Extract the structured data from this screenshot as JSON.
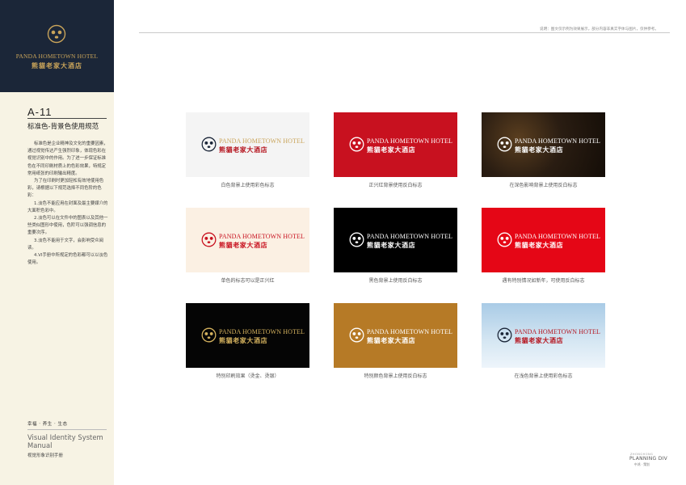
{
  "brand": {
    "name_en": "PANDA HOMETOWN HOTEL",
    "name_cn": "熊貓老家大酒店",
    "colors": {
      "navy": "#1b2638",
      "gold": "#c9a45a",
      "red": "#b5141e",
      "cream": "#f7f3e4"
    }
  },
  "sidebar": {
    "code": "A-11",
    "title": "标准色-背景色使用规范",
    "paragraphs": [
      "标准色是企业精神及文化的重要因素，通过视觉传达产生强烈印象，体现色彩在视觉识别中的作用。为了进一步保证标准色在不同印刷材质上的色彩效果，特规定常用纸张的印刷输出精度。",
      "为了在印刷时更加轻松有效地使用色彩，请根据以下规范选择不同色阶的色彩：",
      "1.淡色不能应用在封面及最主要媒介的大面积色彩中。",
      "2.淡色可以在文件中的图表以及其他一些类似图形中使用，色阶可以强调信息的重要次序。",
      "3.淡色不能用于文字，会影响受众阅读。",
      "4.VI手册中所规定的色彩都可以以淡色使用。"
    ],
    "tagline": "幸福 · 养生 · 生态",
    "manual_en": "Visual Identity System Manual",
    "manual_cn": "视觉形象识别手册"
  },
  "header": {
    "note": "说明：图文仅示例为效果展示，部分内容非真实字体与图片，仅供参考。"
  },
  "cards": [
    {
      "caption": "白色背景上使用彩色标志",
      "bg": "#f4f4f4",
      "text_color": "#c9a45a",
      "cn_color": "#b5141e",
      "mark_color": "#1b2638"
    },
    {
      "caption": "正兴红背景使用反白标志",
      "bg": "#c8111f",
      "text_color": "#ffffff",
      "cn_color": "#ffffff",
      "mark_color": "#ffffff"
    },
    {
      "caption": "在深色影响背景上使用反白标志",
      "bg": "#2a1d12",
      "text_color": "#ffffff",
      "cn_color": "#ffffff",
      "mark_color": "#ffffff"
    },
    {
      "caption": "单色的标志可以是正兴红",
      "bg": "#fbf0e3",
      "text_color": "#c8111f",
      "cn_color": "#c8111f",
      "mark_color": "#c8111f"
    },
    {
      "caption": "黑色背景上使用反白标志",
      "bg": "#000000",
      "text_color": "#ffffff",
      "cn_color": "#ffffff",
      "mark_color": "#ffffff"
    },
    {
      "caption": "遇有特别情况如新年，可使用反白标志",
      "bg": "#e50616",
      "text_color": "#ffffff",
      "cn_color": "#ffffff",
      "mark_color": "#ffffff"
    },
    {
      "caption": "特别印刷效果（烫金、烫银）",
      "bg": "#050505",
      "text_color": "#d5b25e",
      "cn_color": "#d5b25e",
      "mark_color": "#d5b25e"
    },
    {
      "caption": "特别颜色背景上使用反白标志",
      "bg": "#b67a26",
      "text_color": "#ffffff",
      "cn_color": "#ffffff",
      "mark_color": "#ffffff"
    },
    {
      "caption": "在浅色背景上使用彩色标志",
      "bg": "#bcd6ea",
      "text_color": "#b5141e",
      "cn_color": "#b5141e",
      "mark_color": "#1b2638"
    }
  ],
  "footer": {
    "small": "ZHONGHONG",
    "big": "PLANNING DIV",
    "cn": "中鸿 · 策划"
  }
}
